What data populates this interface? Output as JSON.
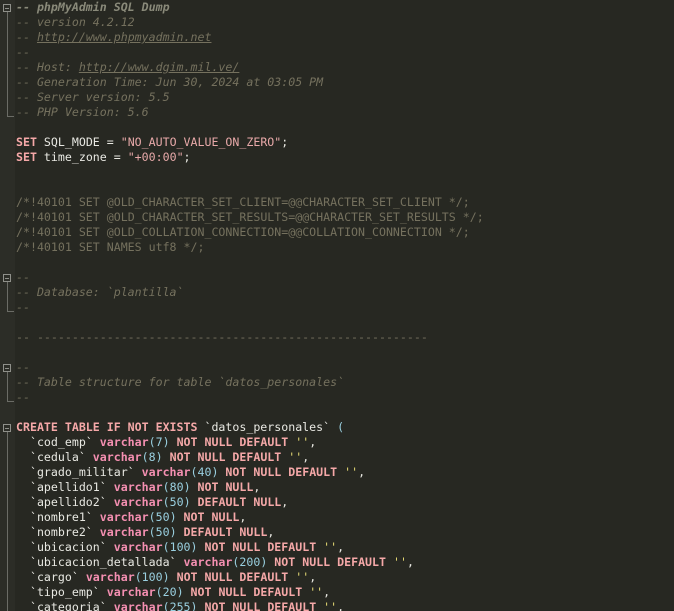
{
  "editor": {
    "header": {
      "title": "-- phpMyAdmin SQL Dump",
      "version": "-- version 4.2.12",
      "url_prefix": "-- ",
      "url": "http://www.phpmyadmin.net",
      "blank": "--",
      "host_prefix": "-- Host: ",
      "host": "http://www.dgim.mil.ve/",
      "generation": "-- Generation Time: Jun 30, 2024 at 03:05 PM",
      "server": "-- Server version: 5.5",
      "php": "-- PHP Version: 5.6"
    },
    "set1": {
      "kw": "SET",
      "name": " SQL_MODE = ",
      "value": "\"NO_AUTO_VALUE_ON_ZERO\"",
      "end": ";"
    },
    "set2": {
      "kw": "SET",
      "name": " time_zone = ",
      "value": "\"+00:00\"",
      "end": ";"
    },
    "charset": [
      {
        "a": "/*!40101 SET @",
        "b": "OLD_CHARACTER_SET_CLIENT=@@CHARACTER_SET_CLIENT */;"
      },
      {
        "a": "/*!40101 SET @",
        "b": "OLD_CHARACTER_SET_RESULTS=@@CHARACTER_SET_RESULTS */;"
      },
      {
        "a": "/*!40101 SET @",
        "b": "OLD_COLLATION_CONNECTION=@@COLLATION_CONNECTION */;"
      },
      {
        "a": "/*!40101 SET NAMES utf8 */;",
        "b": ""
      }
    ],
    "db": {
      "open": "--",
      "label": "-- Database: `plantilla`",
      "close": "--"
    },
    "separator": "-- --------------------------------------------------------",
    "table_comment": {
      "open": "--",
      "label": "-- Table structure for table `datos_personales`",
      "close": "--"
    },
    "create": {
      "kw": "CREATE TABLE IF NOT EXISTS",
      "name": " `datos_personales` ",
      "paren": "("
    },
    "columns": [
      {
        "name": "  `cod_emp` ",
        "type": "varchar",
        "open": "(",
        "size": "7",
        "close": ")",
        "mod": " NOT NULL DEFAULT ",
        "def": "''",
        "end": ","
      },
      {
        "name": "  `cedula` ",
        "type": "varchar",
        "open": "(",
        "size": "8",
        "close": ")",
        "mod": " NOT NULL DEFAULT ",
        "def": "''",
        "end": ","
      },
      {
        "name": "  `grado_militar` ",
        "type": "varchar",
        "open": "(",
        "size": "40",
        "close": ")",
        "mod": " NOT NULL DEFAULT ",
        "def": "''",
        "end": ","
      },
      {
        "name": "  `apellido1` ",
        "type": "varchar",
        "open": "(",
        "size": "80",
        "close": ")",
        "mod": " NOT NULL",
        "def": "",
        "end": ","
      },
      {
        "name": "  `apellido2` ",
        "type": "varchar",
        "open": "(",
        "size": "50",
        "close": ")",
        "mod": " DEFAULT NULL",
        "def": "",
        "end": ","
      },
      {
        "name": "  `nombre1` ",
        "type": "varchar",
        "open": "(",
        "size": "50",
        "close": ")",
        "mod": " NOT NULL",
        "def": "",
        "end": ","
      },
      {
        "name": "  `nombre2` ",
        "type": "varchar",
        "open": "(",
        "size": "50",
        "close": ")",
        "mod": " DEFAULT NULL",
        "def": "",
        "end": ","
      },
      {
        "name": "  `ubicacion` ",
        "type": "varchar",
        "open": "(",
        "size": "100",
        "close": ")",
        "mod": " NOT NULL DEFAULT ",
        "def": "''",
        "end": ","
      },
      {
        "name": "  `ubicacion_detallada` ",
        "type": "varchar",
        "open": "(",
        "size": "200",
        "close": ")",
        "mod": " NOT NULL DEFAULT ",
        "def": "''",
        "end": ","
      },
      {
        "name": "  `cargo` ",
        "type": "varchar",
        "open": "(",
        "size": "100",
        "close": ")",
        "mod": " NOT NULL DEFAULT ",
        "def": "''",
        "end": ","
      },
      {
        "name": "  `tipo_emp` ",
        "type": "varchar",
        "open": "(",
        "size": "20",
        "close": ")",
        "mod": " NOT NULL DEFAULT ",
        "def": "''",
        "end": ","
      },
      {
        "name": "  `categoria` ",
        "type": "varchar",
        "open": "(",
        "size": "255",
        "close": ")",
        "mod": " NOT NULL DEFAULT ",
        "def": "''",
        "end": ","
      }
    ]
  }
}
